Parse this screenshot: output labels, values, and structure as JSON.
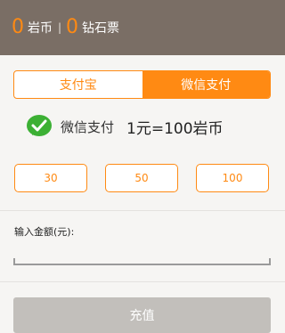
{
  "header": {
    "rock_coins_value": "0",
    "rock_coins_label": "岩币",
    "separator": "|",
    "diamond_tickets_value": "0",
    "diamond_tickets_label": "钻石票"
  },
  "payment_tabs": [
    {
      "label": "支付宝",
      "active": false
    },
    {
      "label": "微信支付",
      "active": true
    }
  ],
  "pay_info": {
    "icon": "wechat-icon",
    "method_name": "微信支付",
    "rate": "1元=100岩币"
  },
  "amounts": [
    "30",
    "50",
    "100"
  ],
  "input": {
    "label": "输入金额(元):",
    "value": ""
  },
  "recharge_button": "充值",
  "colors": {
    "accent": "#ff8a13",
    "header_bg": "#7a6e65",
    "wechat_green": "#3cb034",
    "disabled_button": "#c2bfbb"
  }
}
